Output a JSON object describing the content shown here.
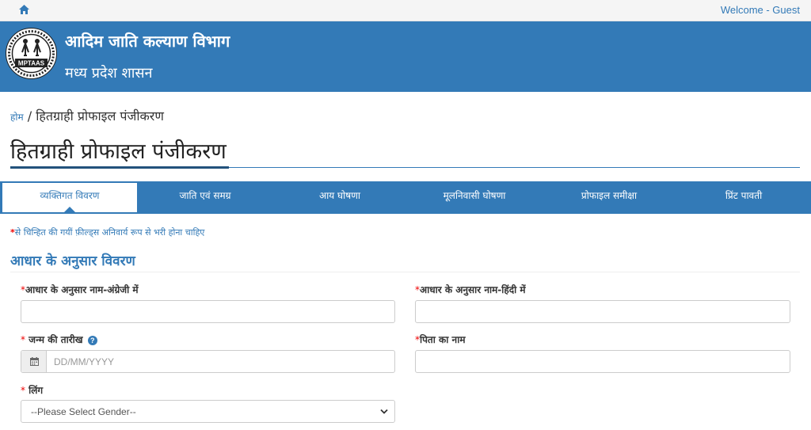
{
  "topbar": {
    "home_icon": "home-icon",
    "welcome": "Welcome - Guest"
  },
  "header": {
    "logo_text": "MPTAAS",
    "title": "आदिम जाति कल्याण विभाग",
    "subtitle": "मध्य प्रदेश शासन",
    "bg_color": "#337ab7"
  },
  "breadcrumb": {
    "home": "होम",
    "separator": " / ",
    "current": "हितग्राही प्रोफाइल पंजीकरण"
  },
  "page_title": "हितग्राही प्रोफाइल पंजीकरण",
  "tabs": [
    {
      "label": "व्यक्तिगत विवरण",
      "active": true
    },
    {
      "label": "जाति एवं समग्र",
      "active": false
    },
    {
      "label": "आय घोषणा",
      "active": false
    },
    {
      "label": "मूलनिवासी घोषणा",
      "active": false
    },
    {
      "label": "प्रोफाइल समीक्षा",
      "active": false
    },
    {
      "label": "प्रिंट पावती",
      "active": false
    }
  ],
  "required_note": {
    "star": "*",
    "text": "से चिन्हित की गयीं फ़ील्ड्स अनिवार्य रूप से भरी होना चाहिए"
  },
  "section": {
    "title": "आधार के अनुसार विवरण"
  },
  "form": {
    "required_mark": "*",
    "name_en": {
      "label": "आधार के अनुसार नाम-अंग्रेजी में",
      "value": ""
    },
    "name_hi": {
      "label": "आधार के अनुसार नाम-हिंदी में",
      "value": ""
    },
    "dob": {
      "label": " जन्म की तारीख",
      "placeholder": "DD/MM/YYYY",
      "help_icon": "question-circle-icon",
      "calendar_icon": "calendar-icon",
      "help_glyph": "?"
    },
    "father_name": {
      "label": "पिता का नाम",
      "value": ""
    },
    "gender": {
      "label": " लिंग",
      "selected": "--Please Select Gender--"
    }
  }
}
